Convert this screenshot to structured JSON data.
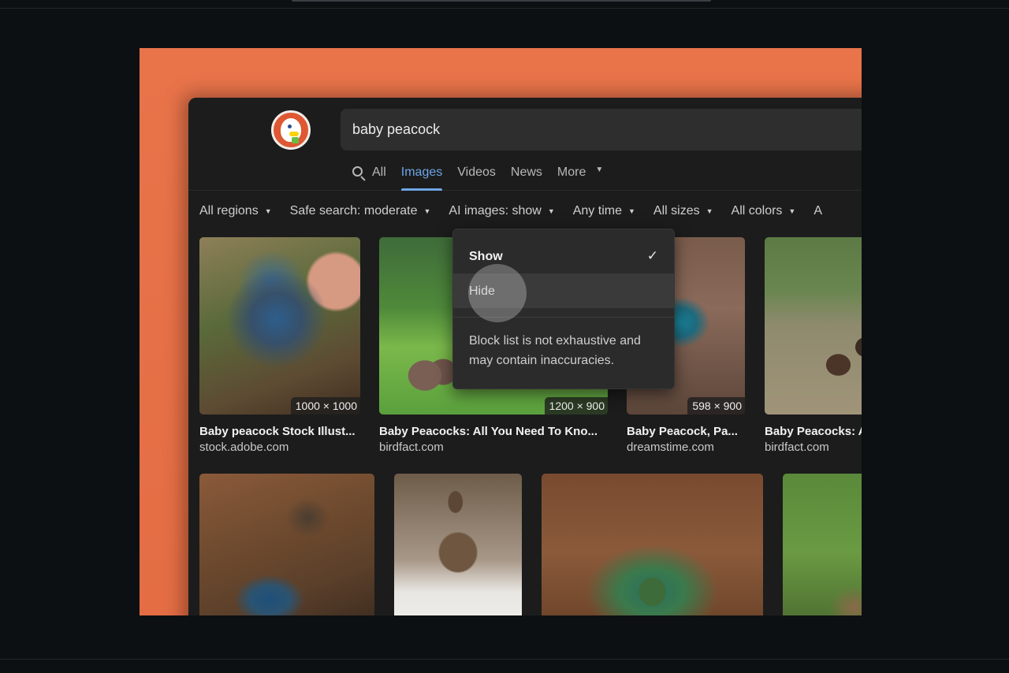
{
  "search": {
    "query": "baby peacock"
  },
  "tabs": [
    {
      "label": "All",
      "icon": "search-icon"
    },
    {
      "label": "Images"
    },
    {
      "label": "Videos"
    },
    {
      "label": "News"
    },
    {
      "label": "More",
      "caret": "▼"
    }
  ],
  "filters": [
    {
      "label": "All regions",
      "caret": "▼"
    },
    {
      "label": "Safe search: moderate",
      "caret": "▼"
    },
    {
      "label": "AI images: show",
      "caret": "▼"
    },
    {
      "label": "Any time",
      "caret": "▼"
    },
    {
      "label": "All sizes",
      "caret": "▼"
    },
    {
      "label": "All colors",
      "caret": "▼"
    },
    {
      "label": "A"
    }
  ],
  "results": [
    {
      "title": "Baby peacock Stock Illust...",
      "source": "stock.adobe.com",
      "dims": "1000 × 1000"
    },
    {
      "title": "Baby Peacocks: All You Need To Kno...",
      "source": "birdfact.com",
      "dims": "1200 × 900"
    },
    {
      "title": "Baby Peacock, Pa...",
      "source": "dreamstime.com",
      "dims": "598 × 900"
    },
    {
      "title": "Baby Peacocks: A",
      "source": "birdfact.com",
      "dims": ""
    }
  ],
  "ai_dropdown": {
    "options": [
      {
        "label": "Show",
        "checkmark": "✓"
      },
      {
        "label": "Hide"
      }
    ],
    "note": "Block list is not exhaustive and may contain inaccuracies."
  },
  "colors": {
    "stage_background": "#e9744a",
    "window_background": "#1c1c1c",
    "active_tab": "#6ea6e6",
    "brand_orange": "#de5833"
  }
}
